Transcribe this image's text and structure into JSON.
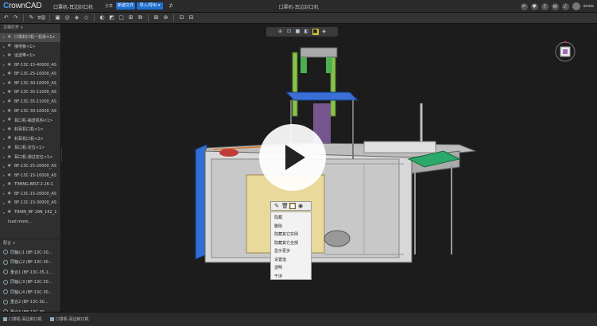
{
  "app": {
    "logo_c": "C",
    "logo_rest": "rownCAD",
    "doc_name": "口罩机-耳边封口机",
    "share_label": "分享",
    "new_doc_label": "新建文件",
    "import_export_label": "导入/导出 ▾",
    "center_title": "口罩机-耳边封口机",
    "user_name": "anwe"
  },
  "toolbar": {
    "sketch_label": "草图"
  },
  "tree": {
    "header": "文档打开 ∨",
    "items": [
      {
        "label": "口罩封口机一机体<1>",
        "selected": true
      },
      {
        "label": "接地板<1>"
      },
      {
        "label": "运送带<1>"
      },
      {
        "label": "BF-13C-15-40000_AS"
      },
      {
        "label": "BF-13C-25-10000_AS"
      },
      {
        "label": "BF-13C-30-10000_AS"
      },
      {
        "label": "BF-13C-35-11000_AS"
      },
      {
        "label": "BF-13C-35-11000_AS"
      },
      {
        "label": "BF-13C-30-10000_AS"
      },
      {
        "label": "耳口机-输送机构<1>"
      },
      {
        "label": "封耳机口机<1>"
      },
      {
        "label": "封耳机口机<2>"
      },
      {
        "label": "耳口机-定位<1>"
      },
      {
        "label": "耳口机-通过定位<1>"
      },
      {
        "label": "BF-13C-25-20000_AS"
      },
      {
        "label": "BF-13C-15-10000_AS"
      },
      {
        "label": "TIMING-BELT-2-26-1"
      },
      {
        "label": "BF-13C-15-20000_AS"
      },
      {
        "label": "BF-13C-15-30000_AS"
      },
      {
        "label": "TRAIN_BF-19N_162_1"
      },
      {
        "label": "load more..."
      }
    ]
  },
  "mates": {
    "header": "配合 ∨",
    "items": [
      {
        "label": "同轴心1 (BF-13C-30..."
      },
      {
        "label": "同轴心2 (BF-13C-30..."
      },
      {
        "label": "重合1 (BF-13C-35-1..."
      },
      {
        "label": "同轴心3 (BF-13C-30..."
      },
      {
        "label": "同轴心4 (BF-13C-30..."
      },
      {
        "label": "重合2 (BF-13C-30..."
      },
      {
        "label": "重合3 (BF-13C-30..."
      }
    ]
  },
  "context_menu": {
    "items": [
      "隐藏",
      "删除",
      "隐藏其它实例",
      "隐藏其它全部",
      "显示更多",
      "设置值",
      "透明",
      "干涉"
    ]
  },
  "status": {
    "tabs": [
      "口罩机-耳边封口机",
      "口罩机-耳边封口机"
    ]
  },
  "colors": {
    "accent": "#1f6fd1",
    "highlight": "#d8c23a"
  }
}
